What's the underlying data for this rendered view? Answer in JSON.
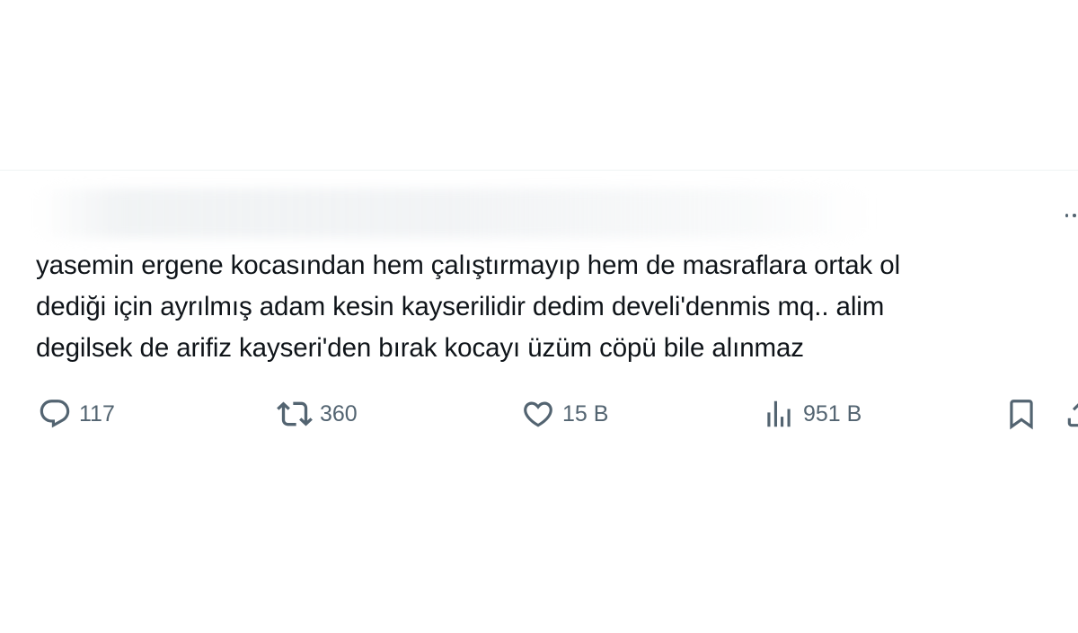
{
  "tweet": {
    "text_lines": [
      "yasemin ergene kocasından hem çalıştırmayıp hem de masraflara ortak ol",
      "dediği için ayrılmış adam kesin kayserilidir dedim develi'denmis mq.. alim",
      "degilsek de arifiz kayseri'den bırak kocayı üzüm cöpü bile alınmaz"
    ]
  },
  "actions": {
    "reply": {
      "icon": "speech-bubble-icon",
      "count": "117"
    },
    "retweet": {
      "icon": "retweet-icon",
      "count": "360"
    },
    "like": {
      "icon": "heart-icon",
      "count": "15 B"
    },
    "views": {
      "icon": "bar-chart-icon",
      "count": "951 B"
    },
    "bookmark": {
      "icon": "bookmark-icon"
    },
    "share": {
      "icon": "share-icon"
    }
  },
  "colors": {
    "text": "#0f1419",
    "secondary": "#536471",
    "divider": "#eff3f4",
    "background": "#ffffff"
  }
}
